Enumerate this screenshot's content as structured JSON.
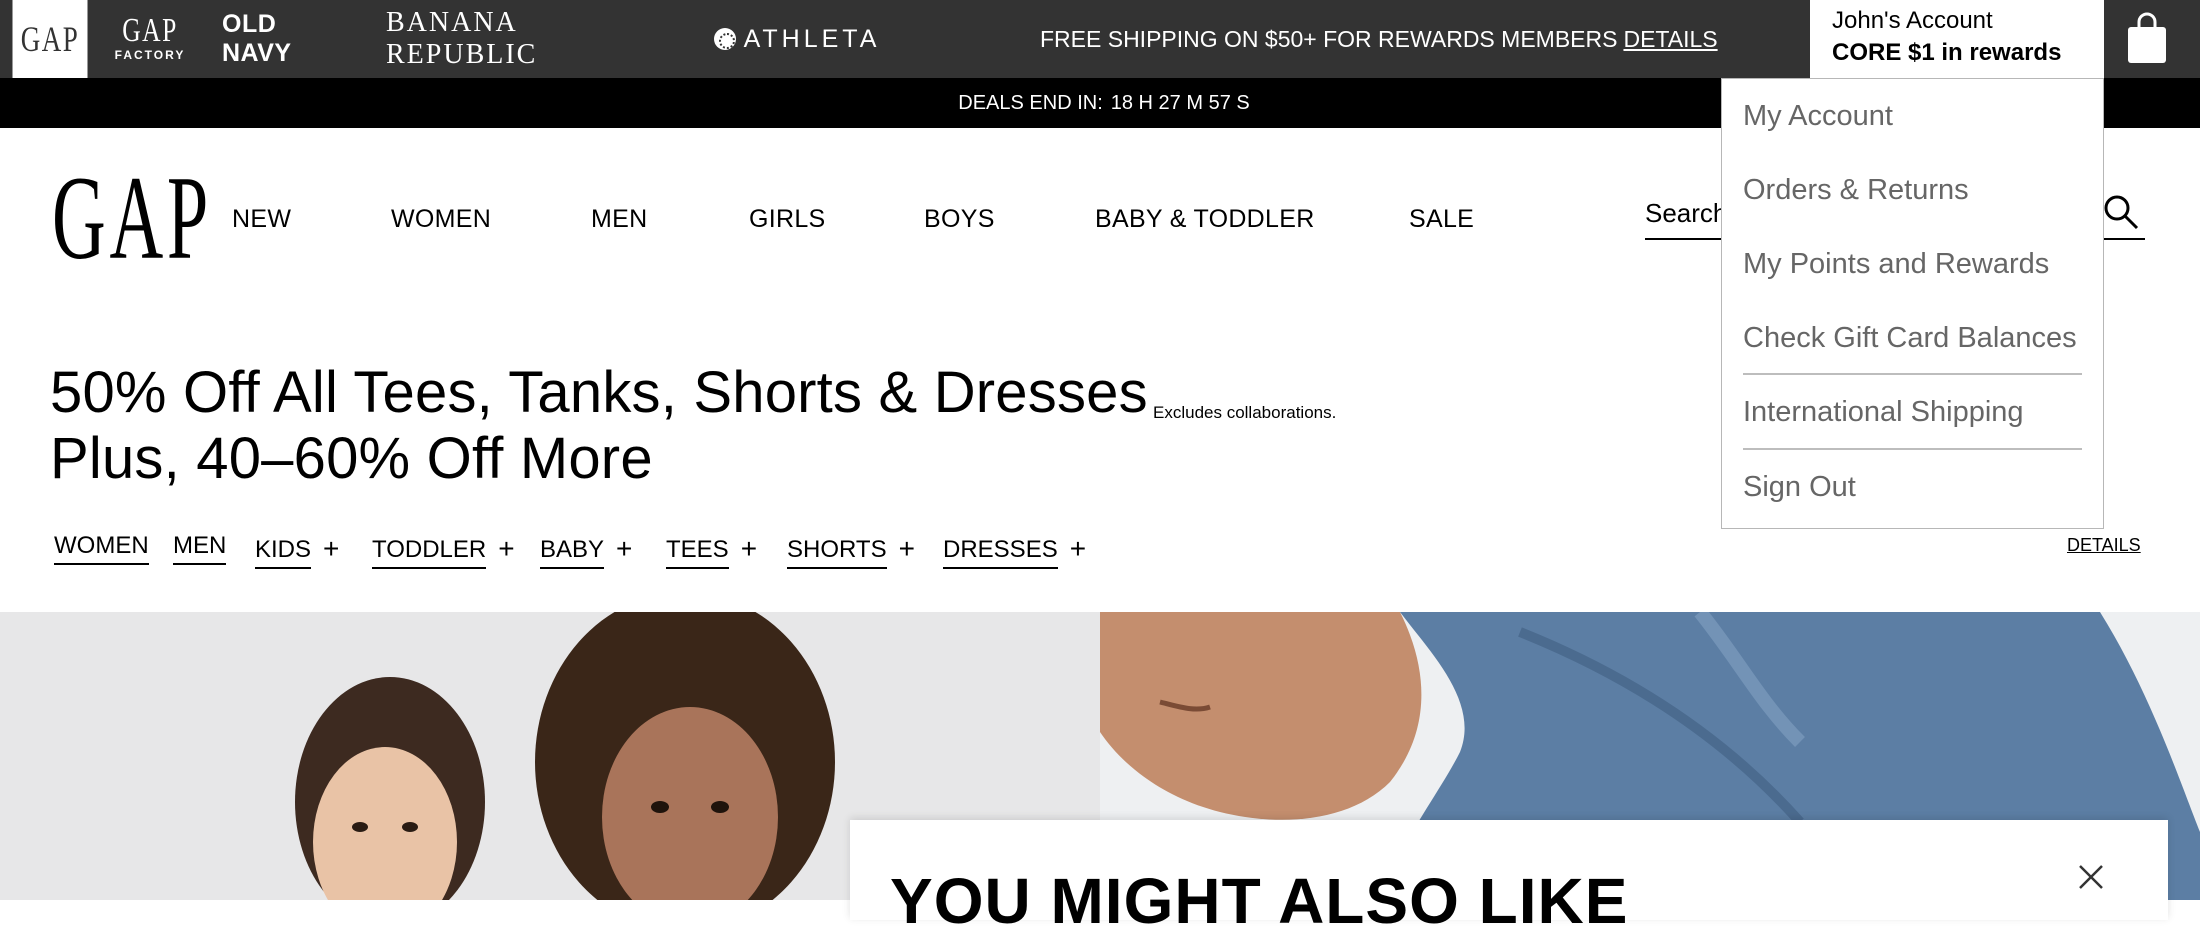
{
  "brands": {
    "gap": "GAP",
    "gap_factory_top": "GAP",
    "gap_factory_bottom": "FACTORY",
    "old_navy": "OLD NAVY",
    "banana_republic": "BANANA REPUBLIC",
    "athleta": "ATHLETA"
  },
  "promo": {
    "text": "FREE SHIPPING ON $50+ FOR REWARDS MEMBERS",
    "link": "DETAILS"
  },
  "account": {
    "name": "John's Account",
    "rewards": "CORE $1 in rewards",
    "icon": "chevron-down-icon"
  },
  "bag_icon": "shopping-bag-icon",
  "deals": {
    "label": "DEALS END IN:",
    "countdown": "18 H 27 M 57 S"
  },
  "logo": "GAP",
  "nav": [
    "NEW",
    "WOMEN",
    "MEN",
    "GIRLS",
    "BOYS",
    "BABY & TODDLER",
    "SALE"
  ],
  "search": {
    "placeholder": "Search",
    "icon": "search-icon"
  },
  "headline": {
    "line1": "50% Off All Tees, Tanks, Shorts & Dresses",
    "line2": "Plus, 40–60% Off More",
    "note": "Excludes collaborations."
  },
  "categories": [
    {
      "label": "WOMEN",
      "plus": ""
    },
    {
      "label": "MEN",
      "plus": ""
    },
    {
      "label": "KIDS",
      "plus": "+"
    },
    {
      "label": "TODDLER",
      "plus": "+"
    },
    {
      "label": "BABY",
      "plus": "+"
    },
    {
      "label": "TEES",
      "plus": "+"
    },
    {
      "label": "SHORTS",
      "plus": "+"
    },
    {
      "label": "DRESSES",
      "plus": "+"
    }
  ],
  "details_link": "DETAILS",
  "dropdown": [
    "My Account",
    "Orders & Returns",
    "My Points and Rewards",
    "Check Gift Card Balances",
    "International Shipping",
    "Sign Out"
  ],
  "modal": {
    "title": "YOU MIGHT ALSO LIKE",
    "close_icon": "close-icon"
  },
  "colors": {
    "topbar": "#333333",
    "dealbar": "#000000",
    "dropdown_text": "#666666"
  }
}
